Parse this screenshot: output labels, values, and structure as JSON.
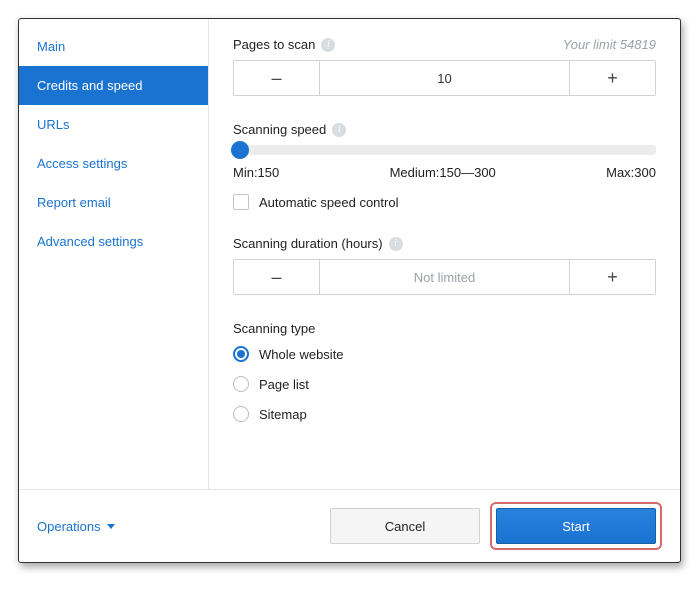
{
  "sidebar": {
    "items": [
      {
        "label": "Main"
      },
      {
        "label": "Credits and speed"
      },
      {
        "label": "URLs"
      },
      {
        "label": "Access settings"
      },
      {
        "label": "Report email"
      },
      {
        "label": "Advanced settings"
      }
    ],
    "activeIndex": 1
  },
  "pages_to_scan": {
    "label": "Pages to scan",
    "limit_text": "Your limit 54819",
    "value": "10"
  },
  "scanning_speed": {
    "label": "Scanning speed",
    "min_label": "Min:150",
    "medium_label": "Medium:150—300",
    "max_label": "Max:300"
  },
  "auto_speed": {
    "label": "Automatic speed control",
    "checked": false
  },
  "scanning_duration": {
    "label": "Scanning duration (hours)",
    "value": "Not limited"
  },
  "scanning_type": {
    "label": "Scanning type",
    "options": [
      {
        "label": "Whole website",
        "checked": true
      },
      {
        "label": "Page list",
        "checked": false
      },
      {
        "label": "Sitemap",
        "checked": false
      }
    ]
  },
  "footer": {
    "operations": "Operations",
    "cancel": "Cancel",
    "start": "Start"
  },
  "glyphs": {
    "minus": "–",
    "plus": "+",
    "info": "i"
  }
}
